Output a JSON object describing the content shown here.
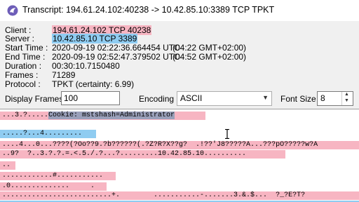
{
  "window": {
    "title": "Transcript: 194.61.24.102:40238 -> 10.42.85.10:3389 TCP TPKT"
  },
  "info": {
    "client_label": "Client :",
    "client_value": "194.61.24.102 TCP 40238",
    "server_label": "Server :",
    "server_value": "10.42.85.10 TCP 3389",
    "start_label": "Start Time :",
    "start_value": "2020-09-19 02:22:36.664454 UTC",
    "start_tz": "(04:22 GMT+02:00)",
    "end_label": "End Time :",
    "end_value": "2020-09-19 02:52:47.379502 UTC",
    "end_tz": "(04:52 GMT+02:00)",
    "duration_label": "Duration :",
    "duration_value": "00:30:10.7150480",
    "frames_label": "Frames :",
    "frames_value": "71289",
    "protocol_label": "Protocol :",
    "protocol_value": "TPKT (certainty: 6.99)"
  },
  "controls": {
    "display_frames_label": "Display Frames",
    "display_frames_value": "100",
    "encoding_label": "Encoding",
    "encoding_value": "ASCII",
    "font_size_label": "Font Size",
    "font_size_value": "8"
  },
  "transcript": {
    "lines": [
      {
        "dir": "client",
        "pre": "...3.?.....",
        "sel": "Cookie: mstshash=Administrator",
        "post": ""
      },
      {
        "dir": "none",
        "pre": "",
        "sel": "",
        "post": ""
      },
      {
        "dir": "server",
        "pre": ".....?...4.........",
        "sel": "",
        "post": ""
      },
      {
        "dir": "client",
        "pre": "....4...0...????(?Oo??9.?b??????(.?Z?R?X??g?  .!??'J8?????A...???pO?????w?A",
        "sel": "",
        "post": ""
      },
      {
        "dir": "client",
        "pre": "..9?  ?..3.?.?.=.<.5./.?...?.........10.42.85.10..........",
        "sel": "",
        "post": ""
      },
      {
        "dir": "client",
        "pre": "..",
        "sel": "",
        "post": ""
      },
      {
        "dir": "client",
        "pre": "............#...........",
        "sel": "",
        "post": ""
      },
      {
        "dir": "client",
        "pre": ".0..............     .",
        "sel": "",
        "post": ""
      },
      {
        "dir": "client",
        "pre": "..........................+.        ...........-.......3.&.$...  ?_?E?T?",
        "sel": "",
        "post": ""
      },
      {
        "dir": "server",
        "pre": "",
        "sel": "",
        "post": ""
      }
    ]
  },
  "colors": {
    "client_highlight": "#f7b5c2",
    "server_highlight": "#8fccf1",
    "selection": "#9aa0ba"
  },
  "icons": {
    "app": "wireshark-fin-icon",
    "cursor": "text-ibeam-cursor",
    "dropdown": "chevron-down-icon"
  }
}
